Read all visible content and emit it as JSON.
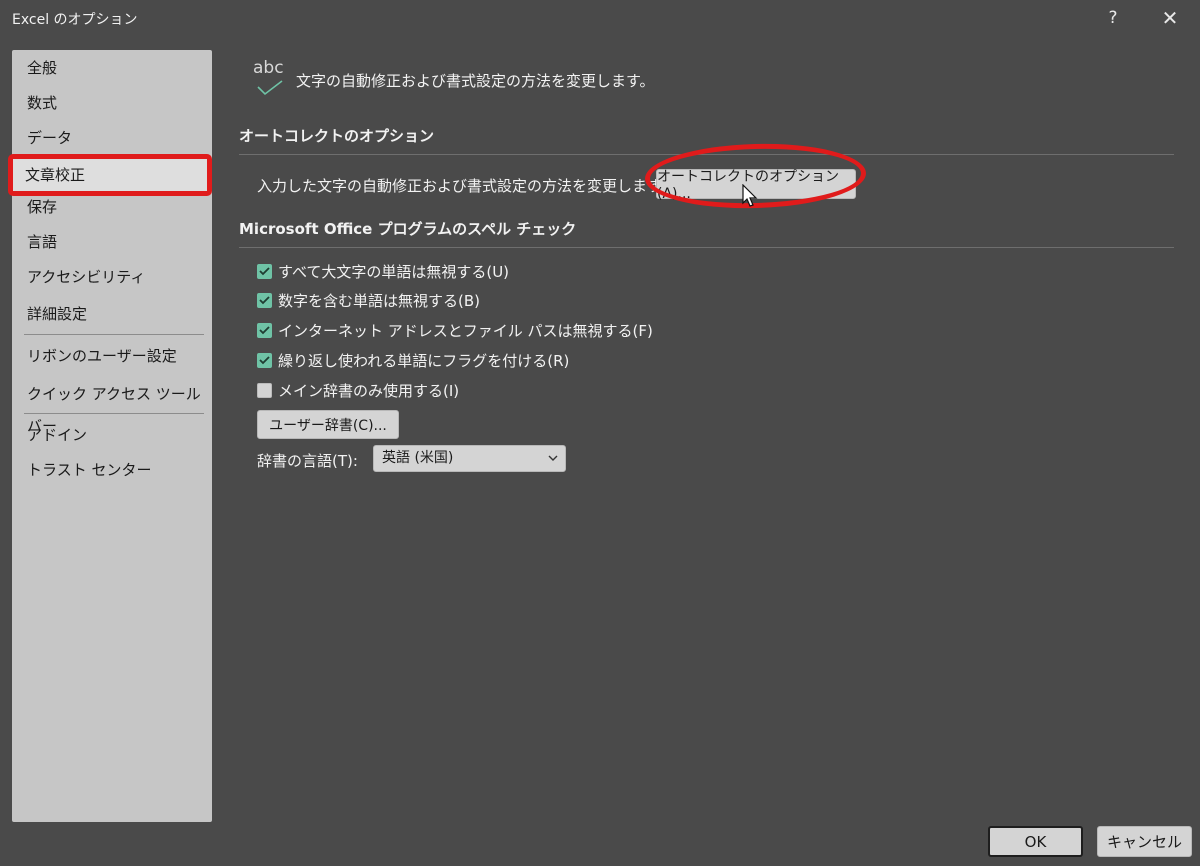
{
  "window": {
    "title": "Excel のオプション",
    "help_label": "?",
    "close_label": "✕"
  },
  "sidebar": {
    "items": [
      {
        "label": "全般"
      },
      {
        "label": "数式"
      },
      {
        "label": "データ"
      },
      {
        "label": "文章校正",
        "selected": true
      },
      {
        "label": "保存"
      },
      {
        "label": "言語"
      },
      {
        "label": "アクセシビリティ"
      },
      {
        "label": "詳細設定"
      },
      {
        "label": "リボンのユーザー設定"
      },
      {
        "label": "クイック アクセス ツール バー"
      },
      {
        "label": "アドイン"
      },
      {
        "label": "トラスト センター"
      }
    ]
  },
  "header": {
    "icon_text": "abc",
    "description": "文字の自動修正および書式設定の方法を変更します。"
  },
  "autocorrect": {
    "section_title": "オートコレクトのオプション",
    "description": "入力した文字の自動修正および書式設定の方法を変更します:",
    "button_label": "オートコレクトのオプション(A)..."
  },
  "spellcheck": {
    "section_title": "Microsoft Office プログラムのスペル チェック",
    "options": [
      {
        "label": "すべて大文字の単語は無視する(U)",
        "checked": true
      },
      {
        "label": "数字を含む単語は無視する(B)",
        "checked": true
      },
      {
        "label": "インターネット アドレスとファイル パスは無視する(F)",
        "checked": true
      },
      {
        "label": "繰り返し使われる単語にフラグを付ける(R)",
        "checked": true
      },
      {
        "label": "メイン辞書のみ使用する(I)",
        "checked": false
      }
    ],
    "user_dict_button": "ユーザー辞書(C)...",
    "dictionary_language_label": "辞書の言語(T):",
    "dictionary_language_value": "英語 (米国)"
  },
  "footer": {
    "ok_label": "OK",
    "cancel_label": "キャンセル"
  },
  "colors": {
    "background": "#4a4a4a",
    "sidebar": "#c6c6c6",
    "annotation_red": "#e01b1b",
    "checkbox_green": "#6fc3a6"
  }
}
